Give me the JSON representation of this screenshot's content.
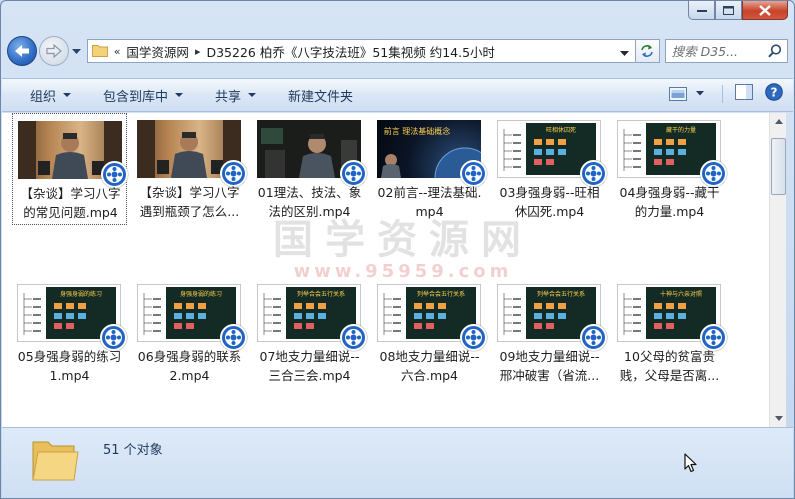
{
  "window": {
    "caption_buttons": [
      "minimize",
      "maximize",
      "close"
    ]
  },
  "address_bar": {
    "chevron": "«",
    "crumbs": [
      "国学资源网",
      "D35226 柏乔《八字技法班》51集视频 约14.5小时"
    ],
    "separator": "▸"
  },
  "search": {
    "placeholder": "搜索 D35..."
  },
  "toolbar": {
    "organize": "组织",
    "include_library": "包含到库中",
    "share": "共享",
    "new_folder": "新建文件夹"
  },
  "files": [
    {
      "name": "【杂谈】学习八字的常见问题.mp4",
      "line1": "【杂谈】学习八字",
      "line2": "的常见问题.mp4",
      "thumb": "studio",
      "selected": true
    },
    {
      "name": "【杂谈】学习八字遇到瓶颈了怎么...",
      "line1": "【杂谈】学习八字",
      "line2": "遇到瓶颈了怎么...",
      "thumb": "studio",
      "selected": false
    },
    {
      "name": "01理法、技法、象法的区别.mp4",
      "line1": "01理法、技法、象",
      "line2": "法的区别.mp4",
      "thumb": "dark",
      "selected": false
    },
    {
      "name": "02前言--理法基础.mp4",
      "line1": "02前言--理法基础.",
      "line2": "mp4",
      "thumb": "space",
      "slide_title": "前言 理法基础概念",
      "selected": false
    },
    {
      "name": "03身强身弱--旺相休囚死.mp4",
      "line1": "03身强身弱--旺相",
      "line2": "休囚死.mp4",
      "thumb": "slide",
      "slide_title": "旺相休囚死",
      "selected": false
    },
    {
      "name": "04身强身弱--藏干的力量.mp4",
      "line1": "04身强身弱--藏干",
      "line2": "的力量.mp4",
      "thumb": "slide",
      "slide_title": "藏干的力量",
      "selected": false
    },
    {
      "name": "05身强身弱的练习1.mp4",
      "line1": "05身强身弱的练习",
      "line2": "1.mp4",
      "thumb": "slide",
      "slide_title": "身强身弱的练习",
      "selected": false
    },
    {
      "name": "06身强身弱的联系2.mp4",
      "line1": "06身强身弱的联系",
      "line2": "2.mp4",
      "thumb": "slide",
      "slide_title": "身强身弱的练习",
      "selected": false
    },
    {
      "name": "07地支力量细说--三合三会.mp4",
      "line1": "07地支力量细说--",
      "line2": "三合三会.mp4",
      "thumb": "slide",
      "slide_title": "列举合会五行关系",
      "selected": false
    },
    {
      "name": "08地支力量细说--六合.mp4",
      "line1": "08地支力量细说--",
      "line2": "六合.mp4",
      "thumb": "slide",
      "slide_title": "列举合会五行关系",
      "selected": false
    },
    {
      "name": "09地支力量细说--邢冲破害（省流...",
      "line1": "09地支力量细说--",
      "line2": "邢冲破害（省流...",
      "thumb": "slide",
      "slide_title": "列举合会五行关系",
      "selected": false
    },
    {
      "name": "10父母的贫富贵贱，父母是否离...",
      "line1": "10父母的贫富贵",
      "line2": "贱，父母是否离...",
      "thumb": "slide",
      "slide_title": "十神与六亲对照",
      "selected": false
    }
  ],
  "watermark": {
    "title": "国学资源网",
    "url": "www.95959.com"
  },
  "status": {
    "count_text": "51 个对象"
  },
  "icons": {
    "back": "back-arrow-icon",
    "forward": "forward-arrow-icon",
    "refresh": "refresh-icon",
    "search": "magnifier-icon",
    "help": "help-icon",
    "view": "view-options-icon",
    "preview_pane": "preview-pane-icon",
    "video_badge": "video-player-icon",
    "folder": "folder-icon"
  },
  "colors": {
    "accent": "#2065c4",
    "toolbar_text": "#1e395b"
  }
}
